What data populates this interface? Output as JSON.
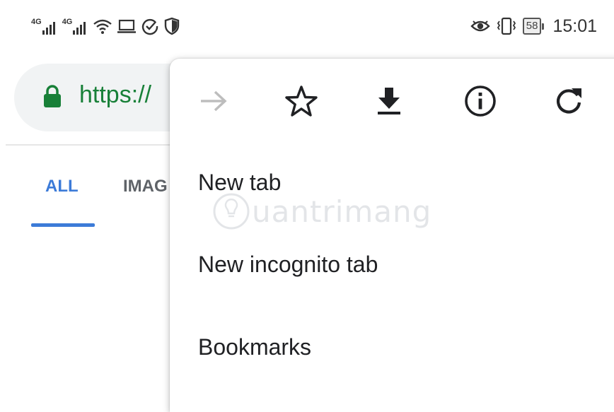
{
  "status_bar": {
    "signal1_tag": "4G",
    "signal2_tag": "4G",
    "icons": [
      "signal-icon",
      "signal-icon",
      "wifi-icon",
      "laptop-icon",
      "check-circle-icon",
      "shield-icon"
    ],
    "right_icons": [
      "eye-icon",
      "vibrate-icon",
      "battery-icon"
    ],
    "battery": "58",
    "time": "15:01"
  },
  "page": {
    "url": "https://",
    "tabs": [
      "ALL",
      "IMAG"
    ]
  },
  "menu": {
    "toolbar_icons": [
      "forward-icon",
      "star-icon",
      "download-icon",
      "info-icon",
      "refresh-icon"
    ],
    "items": [
      "New tab",
      "New incognito tab",
      "Bookmarks"
    ]
  },
  "watermark": {
    "text": "uantrimang"
  },
  "colors": {
    "url_green": "#188038",
    "tab_blue": "#3c7bd8",
    "lock_green": "#188038",
    "disabled_icon": "#bdbdbd",
    "icon": "#202124"
  }
}
